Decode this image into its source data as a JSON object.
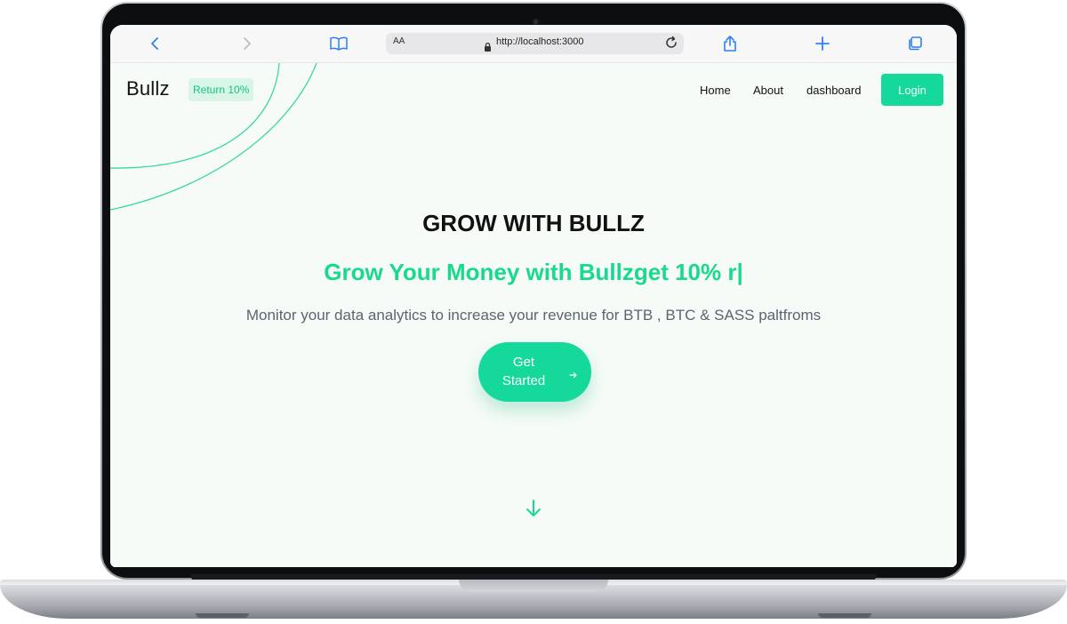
{
  "browser": {
    "url": "http://localhost:3000",
    "reader_label": "AA",
    "icons": [
      "back-icon",
      "forward-icon",
      "bookmarks-icon",
      "lock-icon",
      "reload-icon",
      "share-icon",
      "new-tab-icon",
      "tabs-icon"
    ]
  },
  "site": {
    "brand": "Bullz",
    "badge": "Return 10%",
    "nav": {
      "home": "Home",
      "about": "About",
      "dashboard": "dashboard",
      "login": "Login"
    },
    "hero": {
      "title": "GROW WITH BULLZ",
      "subtitle": "Grow Your Money with Bullzget 10% r|",
      "description": "Monitor your data analytics to increase your revenue for BTB , BTC & SASS paltfroms",
      "cta_line1": "Get",
      "cta_line2": "Started"
    },
    "colors": {
      "accent": "#14d99a",
      "accent_text": "#19d98d",
      "background": "#f6fbf8"
    }
  }
}
